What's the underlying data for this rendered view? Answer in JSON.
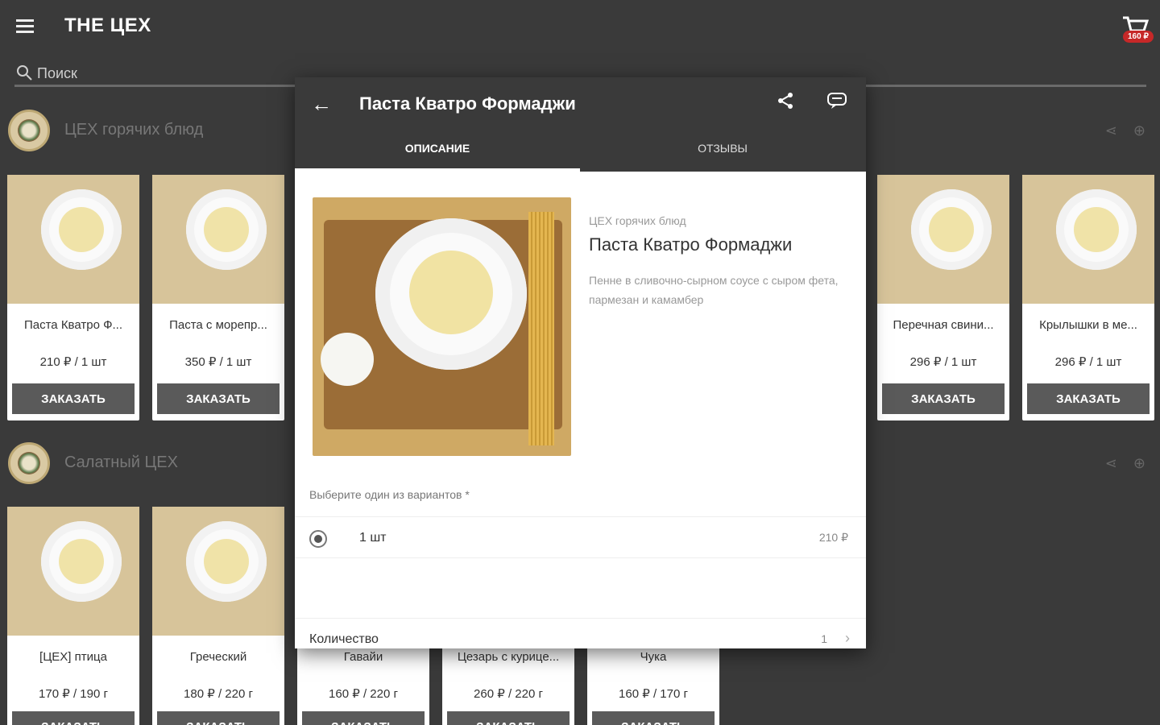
{
  "app": {
    "title": "THE ЦЕХ",
    "cart_badge": "160 ₽"
  },
  "search": {
    "placeholder": "Поиск"
  },
  "categories": [
    {
      "title": "ЦЕХ горячих блюд"
    },
    {
      "title": "Салатный ЦЕХ"
    }
  ],
  "hot_cards": [
    {
      "name": "Паста Кватро Ф...",
      "price": "210 ₽ / 1 шт",
      "button": "ЗАКАЗАТЬ"
    },
    {
      "name": "Паста с морепр...",
      "price": "350 ₽ / 1 шт",
      "button": "ЗАКАЗАТЬ"
    },
    {
      "name": "Перечная свини...",
      "price": "296 ₽ / 1 шт",
      "button": "ЗАКАЗАТЬ"
    },
    {
      "name": "Крылышки в ме...",
      "price": "296 ₽ / 1 шт",
      "button": "ЗАКАЗАТЬ"
    }
  ],
  "salad_cards": [
    {
      "name": "[ЦЕХ] птица",
      "price": "170 ₽ / 190 г",
      "button": "ЗАКАЗАТЬ"
    },
    {
      "name": "Греческий",
      "price": "180 ₽ / 220 г",
      "button": "ЗАКАЗАТЬ"
    },
    {
      "name": "Гавайи",
      "price": "160 ₽ / 220 г",
      "button": "ЗАКАЗАТЬ"
    },
    {
      "name": "Цезарь с курице...",
      "price": "260 ₽ / 220 г",
      "button": "ЗАКАЗАТЬ"
    },
    {
      "name": "Чука",
      "price": "160 ₽ / 170 г",
      "button": "ЗАКАЗАТЬ"
    }
  ],
  "modal": {
    "title": "Паста Кватро Формаджи",
    "tabs": [
      {
        "label": "ОПИСАНИЕ"
      },
      {
        "label": "ОТЗЫВЫ"
      }
    ],
    "dish_category": "ЦЕХ горячих блюд",
    "dish_name": "Паста Кватро Формаджи",
    "description": "Пенне в сливочно-сырном соусе с сыром фета, пармезан и камамбер",
    "options_label": "Выберите один из вариантов *",
    "option": {
      "name": "1 шт",
      "price": "210 ₽"
    },
    "quantity_label": "Количество",
    "quantity_value": "1"
  }
}
